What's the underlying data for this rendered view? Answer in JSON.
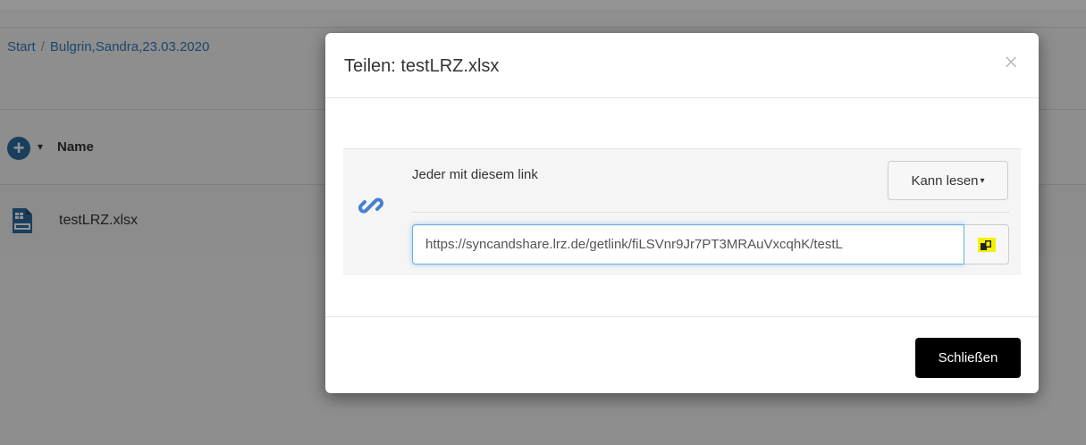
{
  "breadcrumb": {
    "start": "Start",
    "separator": "/",
    "current": "Bulgrin,Sandra,23.03.2020"
  },
  "file_list": {
    "add_icon": "plus-circle-icon",
    "sort_caret": "▾",
    "name_header": "Name",
    "files": [
      {
        "name": "testLRZ.xlsx",
        "icon": "xlsx-file-icon"
      }
    ]
  },
  "modal": {
    "title": "Teilen: testLRZ.xlsx",
    "close_symbol": "×",
    "share": {
      "icon": "link-icon",
      "label": "Jeder mit diesem link",
      "permission": "Kann lesen",
      "permission_caret": "▾",
      "url": "https://syncandshare.lrz.de/getlink/fiLSVnr9Jr7PT3MRAuVxcqhK/testL",
      "copy_icon": "clipboard-copy-icon"
    },
    "footer": {
      "close_label": "Schließen"
    }
  },
  "colors": {
    "link_blue": "#337ab7",
    "focus_blue": "#66afe9",
    "highlight_yellow": "#f2f200",
    "primary_button": "#000000"
  }
}
